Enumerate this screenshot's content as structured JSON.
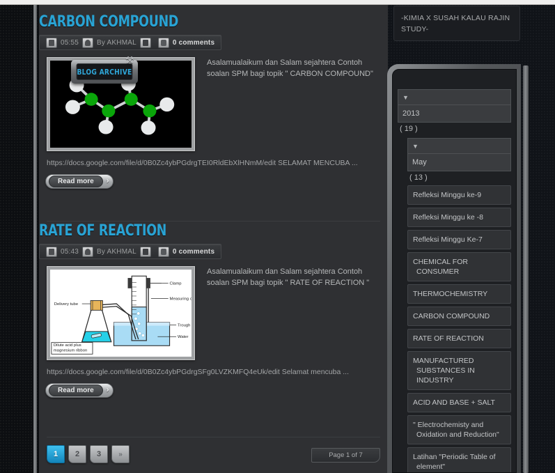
{
  "blurb": {
    "text": "-KIMIA X SUSAH KALAU RAJIN STUDY-"
  },
  "posts": [
    {
      "title": "CARBON COMPOUND",
      "time": "05:55",
      "author": "By AKHMAL",
      "comments": "0 comments",
      "excerpt": "Asalamualaikum dan Salam sejahtera Contoh soalan SPM bagi topik \" CARBON COMPOUND\"",
      "link": "https://docs.google.com/file/d/0B0Zc4ybPGdrgTEI0RldEbXlHNmM/edit SELAMAT MENCUBA ...",
      "read_more": "Read more",
      "read_more_arrow": "›",
      "image_kind": "molecule-model"
    },
    {
      "title": "RATE OF REACTION",
      "time": "05:43",
      "author": "By AKHMAL",
      "comments": "0 comments",
      "excerpt": "Asalamualaikum dan Salam sejahtera Contoh soalan SPM bagi topik \" RATE OF REACTION \"",
      "link": "https://docs.google.com/file/d/0B0Zc4ybPGdrgSFg0LVZKMFQ4eUk/edit Selamat mencuba ...",
      "read_more": "Read more",
      "read_more_arrow": "›",
      "image_kind": "gas-collection-apparatus"
    }
  ],
  "apparatus_labels": {
    "clamp": "Clamp",
    "measuring_cylinder": "Measuring cylinder",
    "delivery_tube": "Delivery tube",
    "trough": "Trough",
    "water": "Water",
    "acid": "Dilute acid plus",
    "acid2": "magnesium ribbon"
  },
  "pagination": {
    "pages": [
      "1",
      "2",
      "3"
    ],
    "next_label": "»",
    "active": "1",
    "indicator": "Page 1 of 7"
  },
  "sidebar": {
    "title": "BLOG ARCHIVE",
    "tool_icon": "⚒",
    "year": {
      "arrow": "▼",
      "label": "2013",
      "count": "( 19 )"
    },
    "month": {
      "arrow": "▼",
      "label": "May",
      "count": "( 13 )"
    },
    "items": [
      "Refleksi Minggu ke-9",
      "Refleksi Minggu ke -8",
      "Refleksi Minggu Ke-7",
      "CHEMICAL FOR CONSUMER",
      "THERMOCHEMISTRY",
      "CARBON COMPOUND",
      "RATE OF REACTION",
      "MANUFACTURED SUBSTANCES IN INDUSTRY",
      "ACID AND BASE + SALT",
      "\" Electrochemisty and Oxidation and Reduction\"",
      "Latihan \"Periodic Table of element\""
    ]
  },
  "colors": {
    "accent": "#29a3d4",
    "panel_bg": "#1e2023",
    "content_bg": "#2f3033"
  }
}
